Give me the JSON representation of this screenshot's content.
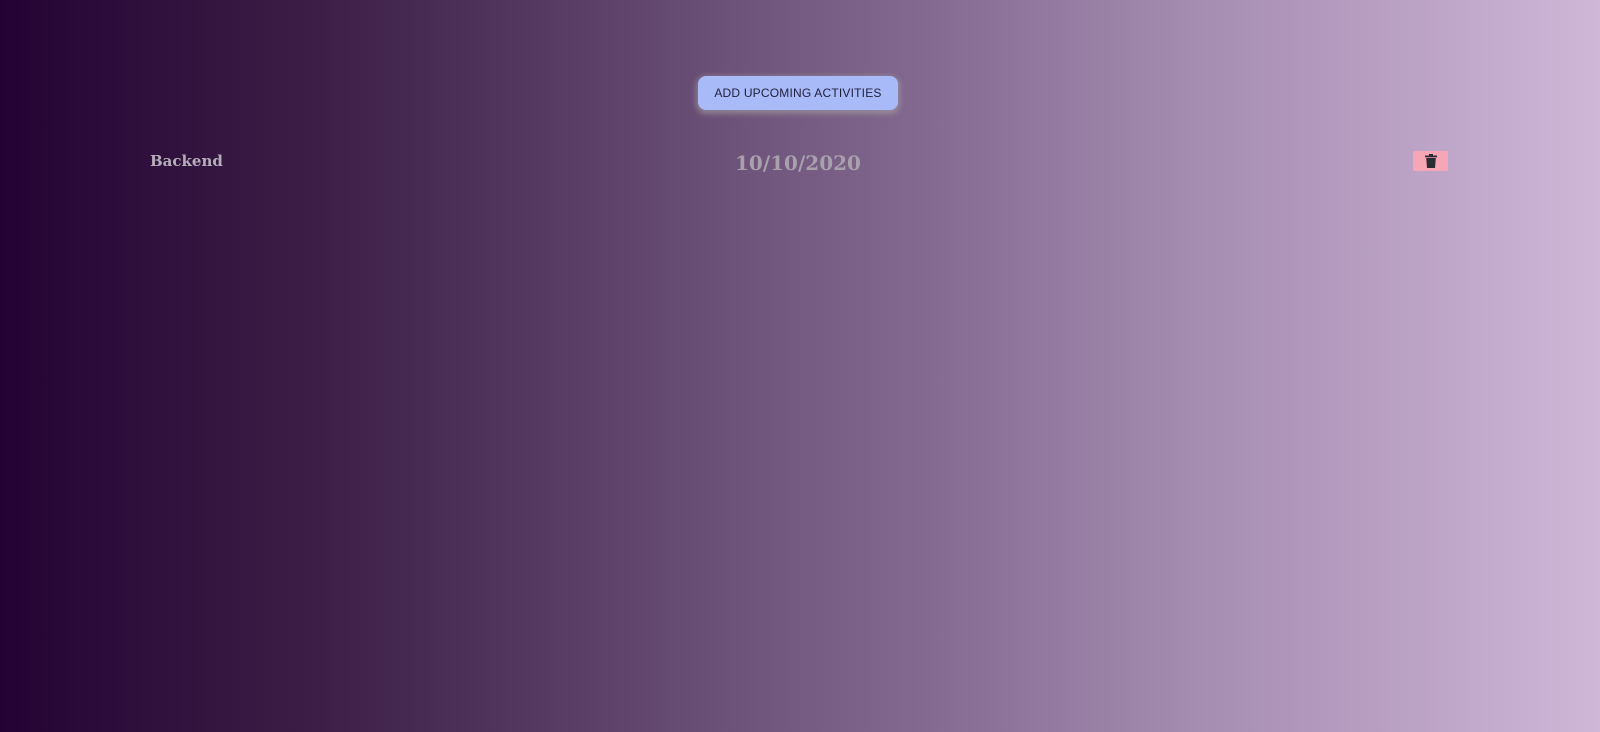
{
  "toolbar": {
    "add_label": "ADD UPCOMING ACTIVITIES"
  },
  "activities": [
    {
      "name": "Backend",
      "date": "10/10/2020",
      "delete_icon": "trash-icon"
    }
  ],
  "colors": {
    "background_start": "#240334",
    "background_end": "#cfb7d8",
    "add_button": "#a9baf8",
    "delete_button": "#f7a6b6",
    "text": "#b5adb9"
  }
}
